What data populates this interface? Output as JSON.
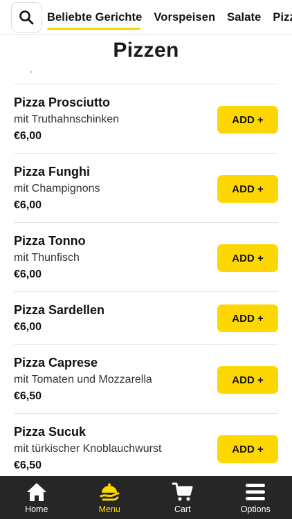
{
  "header": {
    "search_icon": "search-icon",
    "tabs": [
      {
        "label": "Beliebte Gerichte",
        "active": true
      },
      {
        "label": "Vorspeisen",
        "active": false
      },
      {
        "label": "Salate",
        "active": false
      },
      {
        "label": "Pizzen",
        "active": false
      }
    ]
  },
  "section": {
    "title": "Pizzen"
  },
  "items": [
    {
      "name": "Pizza Prosciutto",
      "description": "mit Truthahnschinken",
      "price": "€6,00",
      "button": "ADD +"
    },
    {
      "name": "Pizza Funghi",
      "description": "mit Champignons",
      "price": "€6,00",
      "button": "ADD +"
    },
    {
      "name": "Pizza Tonno",
      "description": "mit Thunfisch",
      "price": "€6,00",
      "button": "ADD +"
    },
    {
      "name": "Pizza Sardellen",
      "description": "",
      "price": "€6,00",
      "button": "ADD +"
    },
    {
      "name": "Pizza Caprese",
      "description": "mit Tomaten und Mozzarella",
      "price": "€6,50",
      "button": "ADD +"
    },
    {
      "name": "Pizza Sucuk",
      "description": "mit türkischer Knoblauchwurst",
      "price": "€6,50",
      "button": "ADD +"
    }
  ],
  "bottom_nav": [
    {
      "label": "Home",
      "icon": "home-icon",
      "active": false
    },
    {
      "label": "Menu",
      "icon": "menu-dish-icon",
      "active": true
    },
    {
      "label": "Cart",
      "icon": "cart-icon",
      "active": false
    },
    {
      "label": "Options",
      "icon": "options-icon",
      "active": false
    }
  ],
  "colors": {
    "accent": "#fed700",
    "nav_background": "#262626",
    "text": "#111111"
  }
}
